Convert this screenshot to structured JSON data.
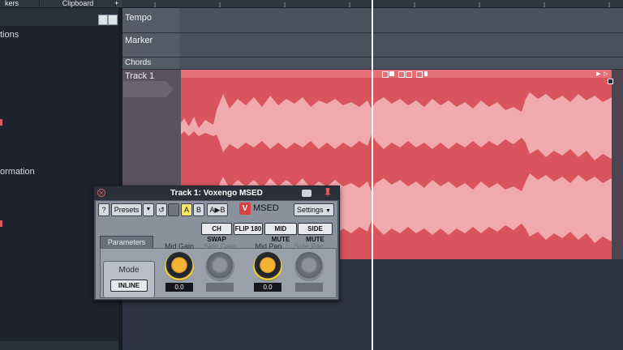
{
  "top_tabs": [
    {
      "label": "kers"
    },
    {
      "label": "Clipboard"
    }
  ],
  "left_panel": {
    "items": [
      {
        "label": "tions"
      },
      {
        "label": "ormation"
      }
    ]
  },
  "lanes": {
    "tempo": "Tempo",
    "marker": "Marker",
    "chords": "Chords",
    "track1": "Track 1"
  },
  "plugin": {
    "title": "Track 1: Voxengo MSED",
    "help_label": "?",
    "presets_label": "Presets",
    "a_label": "A",
    "b_label": "B",
    "ab_label": "A▶B",
    "logo_text": "MSED",
    "settings_label": "Settings",
    "toggles": [
      {
        "label": "CH SWAP",
        "active": false
      },
      {
        "label": "FLIP 180",
        "active": false
      },
      {
        "label": "MID MUTE",
        "active": false
      },
      {
        "label": "SIDE MUTE",
        "active": true
      }
    ],
    "params_tab": "Parameters",
    "mode_label": "Mode",
    "mode_value": "INLINE",
    "knobs": [
      {
        "label": "Mid Gain",
        "value": "0.0",
        "enabled": true
      },
      {
        "label": "Side Gain",
        "value": "",
        "enabled": false
      },
      {
        "label": "Mid Pan",
        "value": "0.0",
        "enabled": true
      },
      {
        "label": "Side Pan",
        "value": "",
        "enabled": false
      }
    ]
  },
  "colors": {
    "clip": "#d9545c",
    "waveform": "#f0a9ad",
    "active_button": "#f5e66a"
  }
}
